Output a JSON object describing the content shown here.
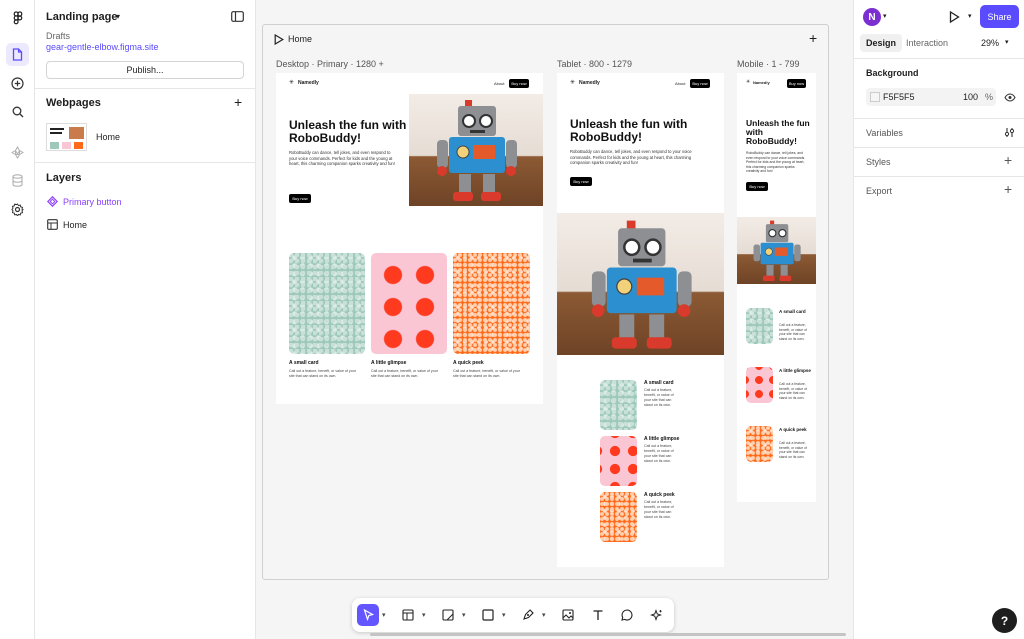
{
  "left_panel": {
    "file_name": "Landing page",
    "project": "Drafts",
    "site_url": "gear-gentle-elbow.figma.site",
    "publish_label": "Publish...",
    "webpages_title": "Webpages",
    "pages": [
      {
        "name": "Home"
      }
    ],
    "layers_title": "Layers",
    "layers": [
      {
        "name": "Primary button",
        "kind": "component",
        "color": "#8a3ffc"
      },
      {
        "name": "Home",
        "kind": "page"
      }
    ]
  },
  "canvas": {
    "board_title": "Home",
    "breakpoints": {
      "desktop": "Desktop · Primary · 1280 +",
      "tablet": "Tablet · 800 - 1279",
      "mobile": "Mobile · 1 - 799"
    },
    "site": {
      "brand": "Namedly",
      "nav_about": "About",
      "buy_label": "Buy now",
      "headline": "Unleash the fun with RoboBuddy!",
      "body": "RoboBuddy can dance, tell jokes, and even respond to your voice commands. Perfect for kids and the young at heart, this charming companion sparks creativity and fun!",
      "cards": [
        {
          "title": "A small card",
          "body": "Call out a feature, benefit, or value of your site that can stand on its own.",
          "style": "mint"
        },
        {
          "title": "A little glimpse",
          "body": "Call out a feature, benefit, or value of your site that can stand on its own.",
          "style": "pink"
        },
        {
          "title": "A quick peek",
          "body": "Call out a feature, benefit, or value of your site that can stand on its own.",
          "style": "orange"
        }
      ]
    }
  },
  "right_panel": {
    "avatar_letter": "N",
    "share_label": "Share",
    "tabs": {
      "design": "Design",
      "interaction": "Interaction"
    },
    "zoom": "29%",
    "background_title": "Background",
    "background_hex": "F5F5F5",
    "background_opacity": "100",
    "opacity_unit": "%",
    "sections": [
      "Variables",
      "Styles",
      "Export"
    ]
  },
  "help_label": "?",
  "colors": {
    "accent": "#5a4bff",
    "component": "#8a3ffc",
    "link": "#5a4bff"
  }
}
